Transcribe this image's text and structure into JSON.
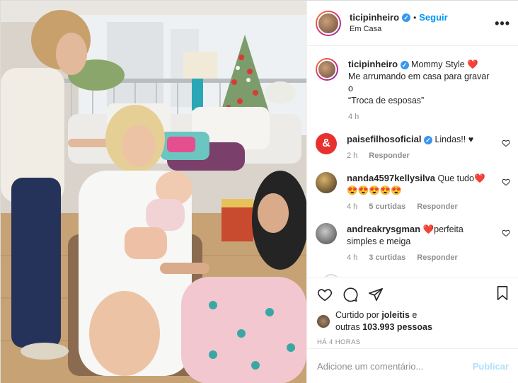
{
  "post": {
    "username": "ticipinheiro",
    "follow_label": "Seguir",
    "separator": "•",
    "location": "Em Casa",
    "more_label": "•••"
  },
  "caption": {
    "username": "ticipinheiro",
    "text_line1": "Mommy Style ❤️",
    "text_line2": "Me arrumando em casa para gravar o",
    "text_line3": "“Troca de esposas”",
    "time": "4 h"
  },
  "comments": [
    {
      "username": "paisefilhosoficial",
      "text": "Lindas!! ♥",
      "time": "2 h",
      "reply_label": "Responder",
      "avatar_color": "#e8312f",
      "avatar_glyph": "&"
    },
    {
      "username": "nanda4597kellysilva",
      "text": "Que tudo❤️",
      "emojis": "😍😍😍😍😍",
      "time": "4 h",
      "likes": "5 curtidas",
      "reply_label": "Responder",
      "avatar_color": "#5a4630"
    },
    {
      "username": "andreakrysgman",
      "text": "❤️perfeita",
      "text_line2": "simples e meiga",
      "time": "4 h",
      "likes": "3 curtidas",
      "reply_label": "Responder",
      "avatar_color": "#7c7c7c"
    }
  ],
  "likes": {
    "prefix": "Curtido por ",
    "user": "joleitis",
    "suffix": " e",
    "line2_prefix": "outras ",
    "count": "103.993",
    "line2_suffix": " pessoas"
  },
  "timestamp": "HÁ 4 HORAS",
  "comment_box": {
    "placeholder": "Adicione um comentário...",
    "publish_label": "Publicar"
  },
  "icons": {
    "like": "heart-icon",
    "comment": "comment-icon",
    "share": "share-icon",
    "save": "bookmark-icon",
    "verified": "verified-badge-icon"
  },
  "colors": {
    "link": "#0095f6",
    "verified": "#3897f0",
    "muted": "#8e8e8e",
    "publish_disabled": "#b2dffc"
  }
}
